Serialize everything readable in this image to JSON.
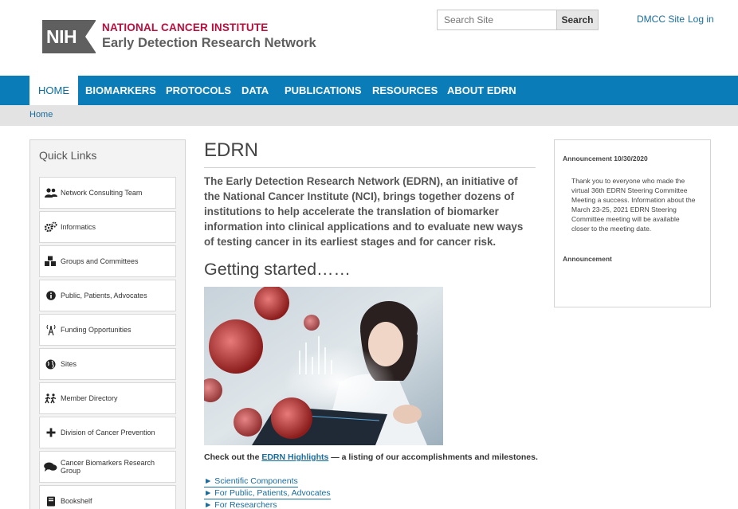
{
  "header": {
    "nih_badge": "NIH",
    "org_name": "NATIONAL CANCER INSTITUTE",
    "site_name": "Early Detection Research Network",
    "search_placeholder": "Search Site",
    "search_button": "Search",
    "links": [
      "DMCC Site",
      "Log in"
    ]
  },
  "nav": {
    "items": [
      "Home",
      "Biomarkers",
      "Protocols",
      "Data",
      "Publications",
      "Resources",
      "About EDRN"
    ],
    "active": "Home"
  },
  "breadcrumb": [
    "Home"
  ],
  "quick_links": {
    "title": "Quick Links",
    "items": [
      {
        "label": "Network Consulting Team",
        "icon": "users-icon"
      },
      {
        "label": "Informatics",
        "icon": "cogs-icon"
      },
      {
        "label": "Groups and Committees",
        "icon": "cubes-icon"
      },
      {
        "label": "Public, Patients, Advocates",
        "icon": "info-circle-icon"
      },
      {
        "label": "Funding Opportunities",
        "icon": "broadcast-tower-icon"
      },
      {
        "label": "Sites",
        "icon": "globe-icon"
      },
      {
        "label": "Member Directory",
        "icon": "people-walking-icon"
      },
      {
        "label": "Division of Cancer Prevention",
        "icon": "plus-icon"
      },
      {
        "label": "Cancer Biomarkers Research Group",
        "icon": "comments-icon"
      },
      {
        "label": "Bookshelf",
        "icon": "book-icon"
      }
    ]
  },
  "main": {
    "title": "EDRN",
    "intro": "The Early Detection Research Network (EDRN), an initiative of the National Cancer Institute (NCI), brings together dozens of institutions to help accelerate the translation of biomarker information into clinical applications and to evaluate new ways of testing cancer in its earliest stages and for cancer risk.",
    "getting_started": "Getting started……",
    "checkout_prefix": "Check out the ",
    "checkout_link": "EDRN Highlights",
    "checkout_suffix": " — a listing of our accomplishments and milestones.",
    "bullet_links": [
      "► Scientific Components",
      "► For Public, Patients, Advocates",
      "► For Researchers"
    ]
  },
  "announcement": {
    "title": "Announcement 10/30/2020",
    "body": "Thank you to everyone who made the virtual 36th EDRN Steering Committee Meeting a success. Information about the March 23-25, 2021 EDRN Steering Committee meeting will be available closer to the meeting date.",
    "title2": "Announcement"
  },
  "colors": {
    "nav_bg": "#0a7db8",
    "nci_red": "#bb0e3d",
    "link": "#1a6c9c"
  }
}
